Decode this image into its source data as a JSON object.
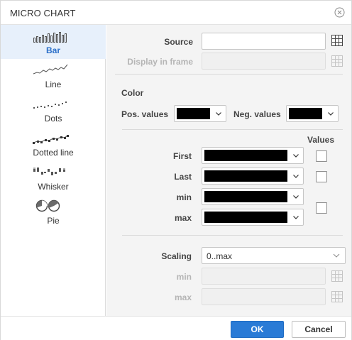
{
  "dialog": {
    "title": "MICRO CHART"
  },
  "sidebar": {
    "items": [
      {
        "label": "Bar",
        "icon": "bar-sparkline-icon",
        "selected": true
      },
      {
        "label": "Line",
        "icon": "line-sparkline-icon",
        "selected": false
      },
      {
        "label": "Dots",
        "icon": "dots-sparkline-icon",
        "selected": false
      },
      {
        "label": "Dotted line",
        "icon": "dotted-line-sparkline-icon",
        "selected": false
      },
      {
        "label": "Whisker",
        "icon": "whisker-sparkline-icon",
        "selected": false
      },
      {
        "label": "Pie",
        "icon": "pie-sparkline-icon",
        "selected": false
      }
    ]
  },
  "source": {
    "source_label": "Source",
    "source_value": "",
    "display_label": "Display in frame",
    "display_value": ""
  },
  "color": {
    "section_label": "Color",
    "pos_label": "Pos. values",
    "neg_label": "Neg. values",
    "pos_color": "#000000",
    "neg_color": "#000000"
  },
  "markers": {
    "values_label": "Values",
    "rows": [
      {
        "label": "First",
        "color": "#000000",
        "checked": false
      },
      {
        "label": "Last",
        "color": "#000000",
        "checked": false
      },
      {
        "label": "min",
        "color": "#000000"
      },
      {
        "label": "max",
        "color": "#000000"
      }
    ],
    "minmax_checked": false
  },
  "scaling": {
    "label": "Scaling",
    "value": "0..max",
    "min_label": "min",
    "max_label": "max",
    "min_value": "",
    "max_value": ""
  },
  "footer": {
    "ok_label": "OK",
    "cancel_label": "Cancel"
  },
  "colors": {
    "accent": "#2a7bd6",
    "selected_bg": "#e7f0fb",
    "panel_bg": "#f4f4f4"
  }
}
